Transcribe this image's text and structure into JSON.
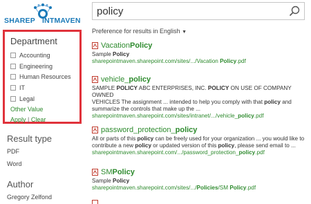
{
  "logo": {
    "part1": "SHAREP",
    "part2": "INT",
    "part3": "MAVEN"
  },
  "search": {
    "value": "policy"
  },
  "preference": "Preference for results in English",
  "refiner": {
    "title": "Department",
    "items": [
      "Accounting",
      "Engineering",
      "Human Resources",
      "IT",
      "Legal"
    ],
    "other_value": "Other Value",
    "apply": "Apply",
    "separator": "|",
    "clear": "Clear"
  },
  "result_type": {
    "title": "Result type",
    "items": [
      "PDF",
      "Word"
    ]
  },
  "author": {
    "title": "Author",
    "items": [
      "Gregory Zelfond"
    ]
  },
  "results": [
    {
      "title_pre": "Vacation ",
      "title_hit": "Policy",
      "title_post": "",
      "body": [
        [
          [
            "Sample ",
            false
          ],
          [
            "Policy",
            true
          ]
        ]
      ],
      "url_pre": "sharepointmaven.sharepoint.com/sites/.../Vacation ",
      "url_hit": "Policy",
      "url_post": ".pdf"
    },
    {
      "title_pre": "vehicle_",
      "title_hit": "policy",
      "title_post": "",
      "body": [
        [
          [
            "SAMPLE ",
            false
          ],
          [
            "POLICY",
            true
          ],
          [
            " ABC ENTERPRISES, INC. ",
            false
          ],
          [
            "POLICY",
            true
          ],
          [
            " ON USE OF COMPANY OWNED",
            false
          ]
        ],
        [
          [
            "VEHICLES The assignment ... intended to help you comply with that ",
            false
          ],
          [
            "policy",
            true
          ],
          [
            " and",
            false
          ]
        ],
        [
          [
            "summarize the controls that make up the ...",
            false
          ]
        ]
      ],
      "url_pre": "sharepointmaven.sharepoint.com/sites/intranet/.../vehicle_",
      "url_hit": "policy",
      "url_post": ".pdf"
    },
    {
      "title_pre": "password_protection_",
      "title_hit": "policy",
      "title_post": "",
      "body": [
        [
          [
            "All or parts of this ",
            false
          ],
          [
            "policy",
            true
          ],
          [
            " can be freely used for your organization ... you would like to",
            false
          ]
        ],
        [
          [
            "contribute a new ",
            false
          ],
          [
            "policy",
            true
          ],
          [
            " or updated version of this ",
            false
          ],
          [
            "policy",
            true
          ],
          [
            ", please send email to ...",
            false
          ]
        ]
      ],
      "url_pre": "sharepointmaven.sharepoint.com/.../password_protection_",
      "url_hit": "policy",
      "url_post": ".pdf"
    },
    {
      "title_pre": "SM ",
      "title_hit": "Policy",
      "title_post": "",
      "body": [
        [
          [
            "Sample ",
            false
          ],
          [
            "Policy",
            true
          ]
        ]
      ],
      "url_pre": "sharepointmaven.sharepoint.com/sites/.../",
      "url_hit": "Policies",
      "url_post": "/SM Policy.pdf",
      "url_post_hit": "Policy"
    }
  ],
  "colors": {
    "accent_green": "#2d8a2d",
    "highlight_red": "#e0323b",
    "brand_blue": "#1b7ab8"
  }
}
